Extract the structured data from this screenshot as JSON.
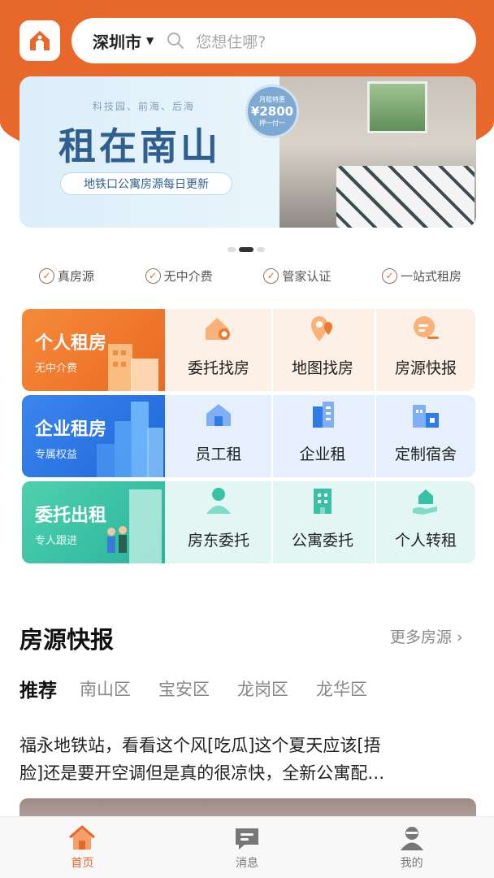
{
  "header": {
    "city": "深圳市",
    "search_placeholder": "您想住哪?"
  },
  "banner": {
    "subtitle": "科技园、前海、后海",
    "title": "租在南山",
    "pill": "地铁口公寓房源每日更新",
    "badge_top": "月租特惠",
    "badge_price": "¥2800",
    "badge_bottom": "押一付一",
    "page_count": 3,
    "active_page": 2
  },
  "features": [
    "真房源",
    "无中介费",
    "管家认证",
    "一站式租房"
  ],
  "services": [
    {
      "title": "个人租房",
      "subtitle": "无中介费",
      "color": "#f07a2c",
      "items": [
        {
          "label": "委托找房",
          "icon": "house-search-icon"
        },
        {
          "label": "地图找房",
          "icon": "map-pin-icon"
        },
        {
          "label": "房源快报",
          "icon": "news-icon"
        }
      ]
    },
    {
      "title": "企业租房",
      "subtitle": "专属权益",
      "color": "#2f7be8",
      "items": [
        {
          "label": "员工租",
          "icon": "house-icon"
        },
        {
          "label": "企业租",
          "icon": "building-icon"
        },
        {
          "label": "定制宿舍",
          "icon": "dorm-icon"
        }
      ]
    },
    {
      "title": "委托出租",
      "subtitle": "专人跟进",
      "color": "#38c1a4",
      "items": [
        {
          "label": "房东委托",
          "icon": "person-icon"
        },
        {
          "label": "公寓委托",
          "icon": "apartment-icon"
        },
        {
          "label": "个人转租",
          "icon": "hand-house-icon"
        }
      ]
    }
  ],
  "section": {
    "title": "房源快报",
    "more": "更多房源"
  },
  "tabs": [
    "推荐",
    "南山区",
    "宝安区",
    "龙岗区",
    "龙华区"
  ],
  "post": {
    "line1": "福永地铁站，看看这个风[吃瓜]这个夏天应该[捂",
    "line2": "脸]还是要开空调但是真的很凉快，全新公寓配…"
  },
  "tabbar": [
    {
      "label": "首页",
      "icon": "home-icon",
      "active": true
    },
    {
      "label": "消息",
      "icon": "message-icon",
      "active": false
    },
    {
      "label": "我的",
      "icon": "profile-icon",
      "active": false
    }
  ],
  "colors": {
    "accent": "#e8672a",
    "row1_bg": "#fdf0e6",
    "row2_bg": "#e6effc",
    "row3_bg": "#e4f6f3"
  }
}
